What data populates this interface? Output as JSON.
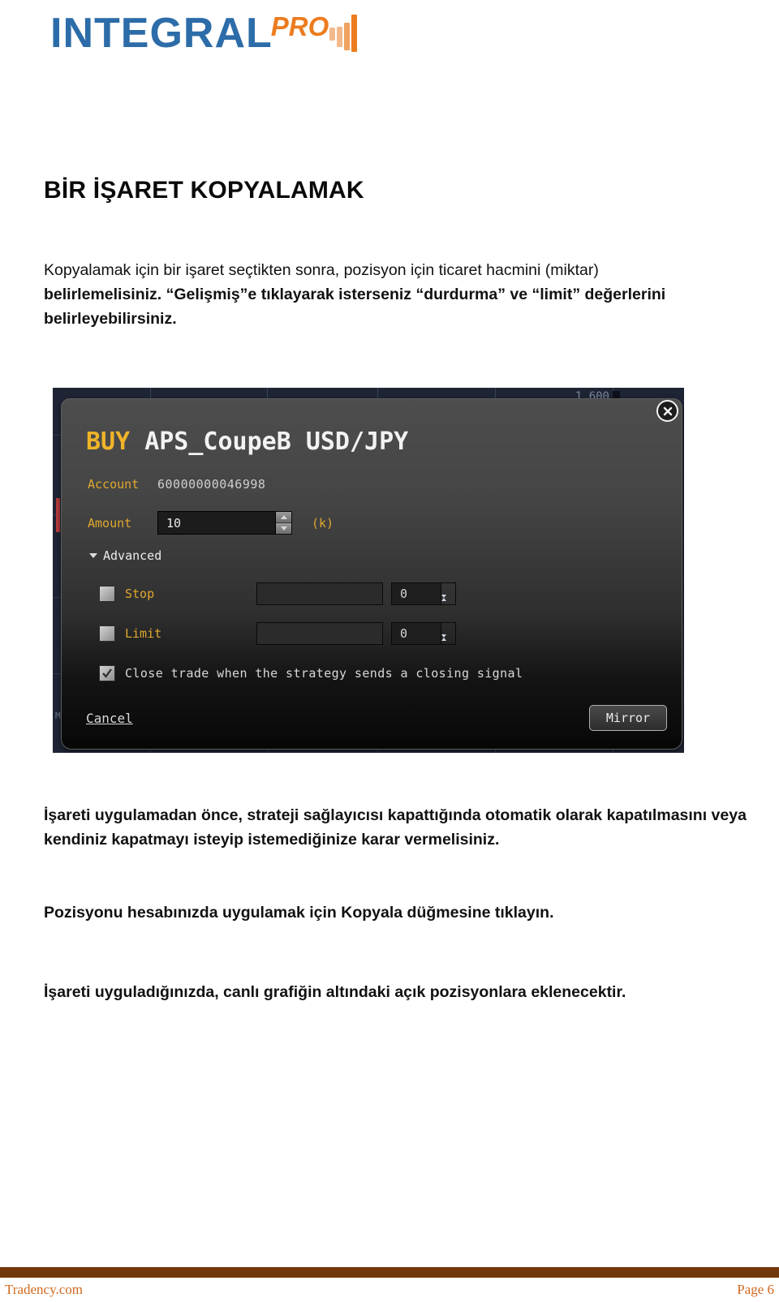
{
  "logo": {
    "primary": "INTEGRAL",
    "secondary": "PRO",
    "primary_color": "#2c6ca8",
    "secondary_color": "#ec7c1f"
  },
  "heading": "BİR İŞARET KOPYALAMAK",
  "paragraphs": {
    "intro_line1": "Kopyalamak için bir işaret seçtikten sonra, pozisyon için ticaret hacmini (miktar)",
    "intro_line2": "belirlemelisiniz.  “Gelişmiş”e tıklayarak isterseniz “durdurma” ve “limit” değerlerini",
    "intro_line3": "belirleyebilirsiniz.",
    "after_a": "İşareti uygulamadan önce, strateji sağlayıcısı kapattığında otomatik olarak kapatılmasını veya kendiniz kapatmayı isteyip istemediğinize karar vermelisiniz.",
    "after_b": "Pozisyonu hesabınızda uygulamak için Kopyala düğmesine tıklayın.",
    "after_c": "İşareti uyguladığınızda, canlı grafiğin altındaki açık pozisyonlara eklenecektir."
  },
  "dialog": {
    "side": "BUY",
    "instrument": "APS_CoupeB",
    "pair": "USD/JPY",
    "close_icon": "close-icon",
    "account_label": "Account",
    "account_value": "60000000046998",
    "amount_label": "Amount",
    "amount_value": "10",
    "amount_unit": "(k)",
    "advanced_label": "Advanced",
    "stop_label": "Stop",
    "stop_value": "",
    "stop_points": "0",
    "limit_label": "Limit",
    "limit_value": "",
    "limit_points": "0",
    "close_signal_label": "Close trade when the strategy sends a closing signal",
    "close_signal_checked": true,
    "cancel_label": "Cancel",
    "mirror_label": "Mirror",
    "background_price": "1.600",
    "accent_gold": "#e0a82e",
    "accent_buy": "#f0b429"
  },
  "footer": {
    "left": "Tradency.com",
    "right": "Page 6",
    "rule_color": "#72370b",
    "text_color": "#d2691e"
  }
}
